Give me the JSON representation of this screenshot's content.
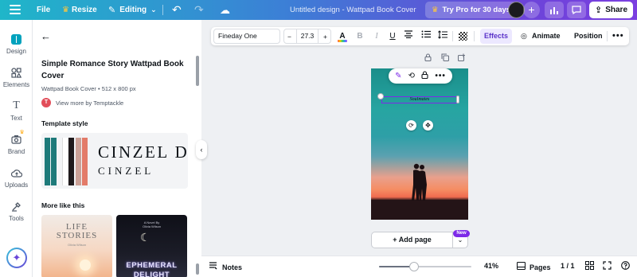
{
  "topbar": {
    "file": "File",
    "resize": "Resize",
    "editing": "Editing",
    "doc_title": "Untitled design - Wattpad Book Cover",
    "try_pro": "Try Pro for 30 days",
    "share": "Share"
  },
  "rail": {
    "items": [
      {
        "label": "Design",
        "icon": "design-icon",
        "active": true
      },
      {
        "label": "Elements",
        "icon": "elements-icon"
      },
      {
        "label": "Text",
        "icon": "text-icon"
      },
      {
        "label": "Brand",
        "icon": "brand-icon"
      },
      {
        "label": "Uploads",
        "icon": "uploads-icon"
      },
      {
        "label": "Tools",
        "icon": "tools-icon"
      }
    ]
  },
  "panel": {
    "title": "Simple Romance Story Wattpad Book Cover",
    "subtitle": "Wattpad Book Cover • 512 x 800 px",
    "author_initial": "T",
    "author_link": "View more by Temptackle",
    "template_style_heading": "Template style",
    "swatches": [
      "#1e7a7a",
      "#1f1a1c",
      "#caa197",
      "#e37b69"
    ],
    "font_sample_1": "CINZEL DEC",
    "font_sample_2": "CINZEL",
    "more_like_heading": "More like this",
    "thumbnails": [
      {
        "line1": "LIFE",
        "line2": "STORIES",
        "byline": "Olivia Wilson"
      },
      {
        "top": "A Novel By\nOlivia Wilson",
        "line1": "EPHEMERAL",
        "line2": "DELIGHT"
      }
    ]
  },
  "context_toolbar": {
    "font": "Fineday One",
    "size_minus": "−",
    "size": "27.3",
    "size_plus": "+",
    "bold": "B",
    "italic": "I",
    "underline": "U",
    "effects": "Effects",
    "animate": "Animate",
    "position": "Position",
    "more": "•••"
  },
  "canvas": {
    "selected_text": "Soulmates",
    "add_page": "+ Add page",
    "new_badge": "New"
  },
  "bottombar": {
    "notes": "Notes",
    "zoom": "41%",
    "zoom_level": 0.38,
    "pages": "Pages",
    "page_count": "1 / 1"
  },
  "colors": {
    "brand_gradient_start": "#1fb6c9",
    "brand_gradient_end": "#7b3fe0",
    "accent_purple": "#7d2ae8",
    "effects_bg": "#ece8ff"
  }
}
